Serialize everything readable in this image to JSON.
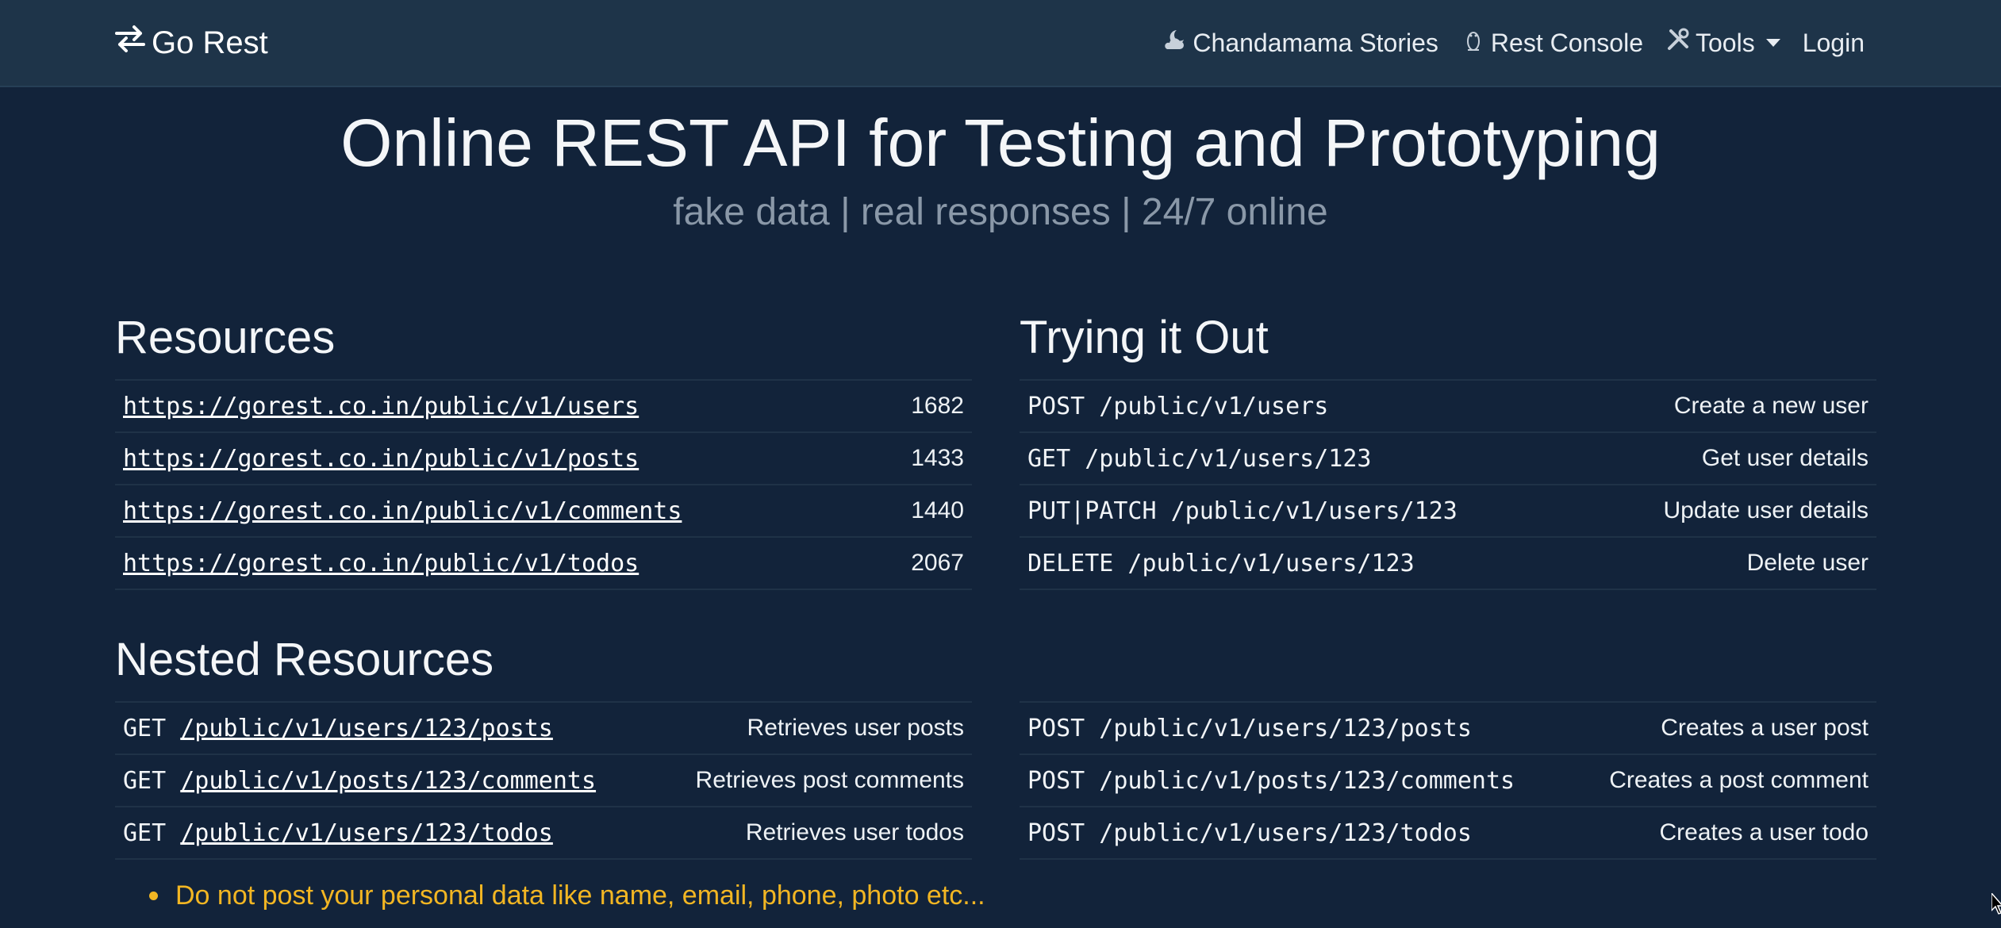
{
  "nav": {
    "brand": "Go Rest",
    "items": [
      {
        "label": "Chandamama Stories",
        "icon": "cloud-moon-icon"
      },
      {
        "label": "Rest Console",
        "icon": "linux-icon"
      },
      {
        "label": "Tools",
        "icon": "tools-icon"
      },
      {
        "label": "Login"
      }
    ]
  },
  "hero": {
    "title": "Online REST API for Testing and Prototyping",
    "subtitle": "fake data | real responses | 24/7 online"
  },
  "resources": {
    "title": "Resources",
    "rows": [
      {
        "url": "https://gorest.co.in/public/v1/users",
        "count": "1682"
      },
      {
        "url": "https://gorest.co.in/public/v1/posts",
        "count": "1433"
      },
      {
        "url": "https://gorest.co.in/public/v1/comments",
        "count": "1440"
      },
      {
        "url": "https://gorest.co.in/public/v1/todos",
        "count": "2067"
      }
    ]
  },
  "trying": {
    "title": "Trying it Out",
    "rows": [
      {
        "request": "POST /public/v1/users",
        "desc": "Create a new user"
      },
      {
        "request": "GET /public/v1/users/123",
        "desc": "Get user details"
      },
      {
        "request": "PUT|PATCH /public/v1/users/123",
        "desc": "Update user details"
      },
      {
        "request": "DELETE /public/v1/users/123",
        "desc": "Delete user"
      }
    ]
  },
  "nested": {
    "title": "Nested Resources",
    "get_rows": [
      {
        "method": "GET",
        "path": "/public/v1/users/123/posts",
        "desc": "Retrieves user posts"
      },
      {
        "method": "GET",
        "path": "/public/v1/posts/123/comments",
        "desc": "Retrieves post comments"
      },
      {
        "method": "GET",
        "path": "/public/v1/users/123/todos",
        "desc": "Retrieves user todos"
      }
    ],
    "post_rows": [
      {
        "request": "POST /public/v1/users/123/posts",
        "desc": "Creates a user post"
      },
      {
        "request": "POST /public/v1/posts/123/comments",
        "desc": "Creates a post comment"
      },
      {
        "request": "POST /public/v1/users/123/todos",
        "desc": "Creates a user todo"
      }
    ]
  },
  "warning": "Do not post your personal data like name, email, phone, photo etc...",
  "colors": {
    "background": "#12233a",
    "navbar": "#1e3449",
    "warning": "#f2b623",
    "muted": "#8a98a8"
  }
}
